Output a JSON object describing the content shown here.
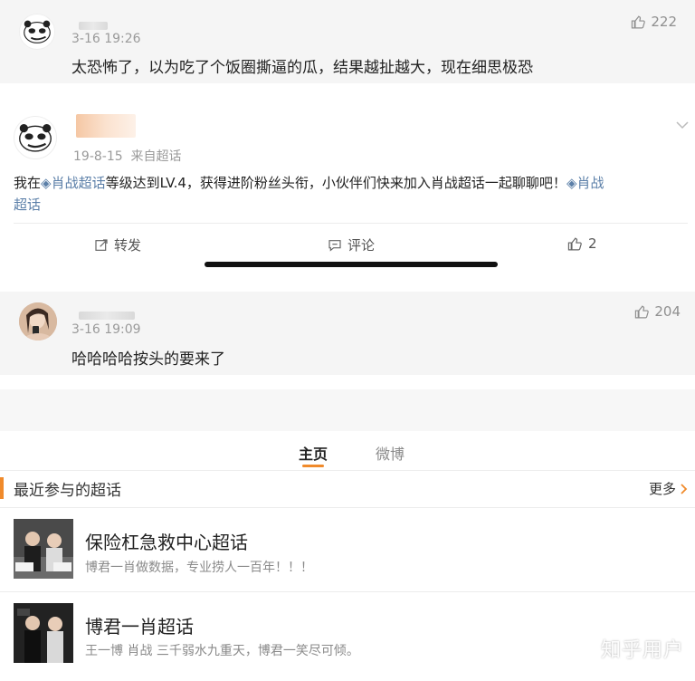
{
  "comments": [
    {
      "time": "3-16 19:26",
      "likes": "222",
      "text": "太恐怖了，以为吃了个饭圈撕逼的瓜，结果越扯越大，现在细思极恐"
    },
    {
      "time": "3-16 19:09",
      "likes": "204",
      "text": "哈哈哈哈按头的要来了"
    }
  ],
  "weibo_card": {
    "date": "19-8-15",
    "source": "来自超话",
    "text_before": "我在",
    "topic_link": "肖战超话",
    "text_middle": "等级达到LV.4，获得进阶粉丝头衔，小伙伴们快来加入肖战超话一起聊聊吧！",
    "topic_link_2_line1": "肖战",
    "topic_link_2_line2": "超话",
    "actions": {
      "repost": "转发",
      "comment": "评论",
      "like_count": "2"
    }
  },
  "tabs": [
    {
      "label": "主页",
      "active": true
    },
    {
      "label": "微博",
      "active": false
    }
  ],
  "section": {
    "title": "最近参与的超话",
    "more": "更多"
  },
  "topics": [
    {
      "title": "保险杠急救中心超话",
      "desc": "博君一肖做数据，专业捞人一百年！！！"
    },
    {
      "title": "博君一肖超话",
      "desc": "王一博 肖战 三千弱水九重天，博君一笑尽可倾。"
    }
  ],
  "watermark": "知乎用户",
  "colors": {
    "accent": "#f08a2b",
    "link": "#5b7fa8"
  },
  "icons": [
    "panda-meme-avatar",
    "thumb-up-icon",
    "repost-icon",
    "comment-icon",
    "chevron-down-icon",
    "chevron-right-icon"
  ]
}
